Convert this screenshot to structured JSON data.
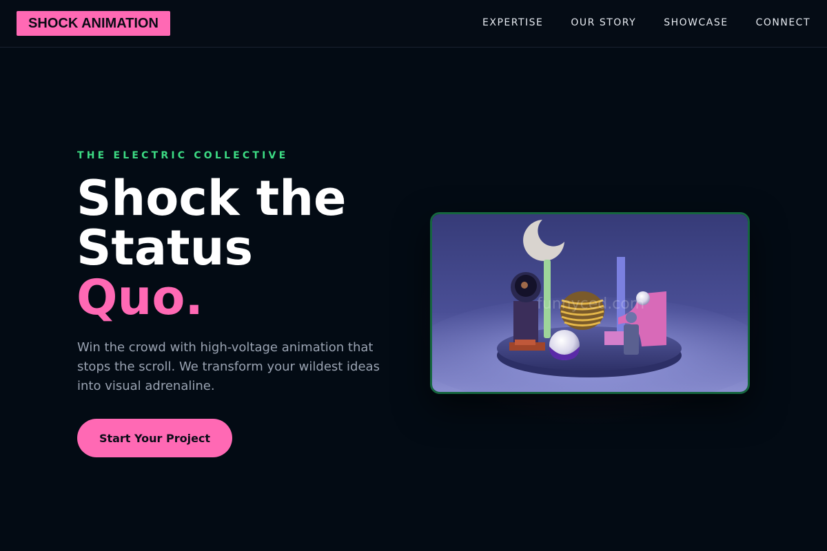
{
  "brand": {
    "logo_text": "SHOCK ANIMATION",
    "accent": "#ff69b4",
    "green": "#3ddc84"
  },
  "nav": {
    "items": [
      "EXPERTISE",
      "OUR STORY",
      "SHOWCASE",
      "CONNECT"
    ]
  },
  "hero": {
    "eyebrow": "THE ELECTRIC COLLECTIVE",
    "headline_line1": "Shock the",
    "headline_line2": "Status",
    "headline_accent": "Quo.",
    "lead": "Win the crowd with high-voltage animation that stops the scroll. We transform your wildest ideas into visual adrenaline.",
    "cta_label": "Start Your Project"
  },
  "media": {
    "watermark": "funnyced.com"
  }
}
